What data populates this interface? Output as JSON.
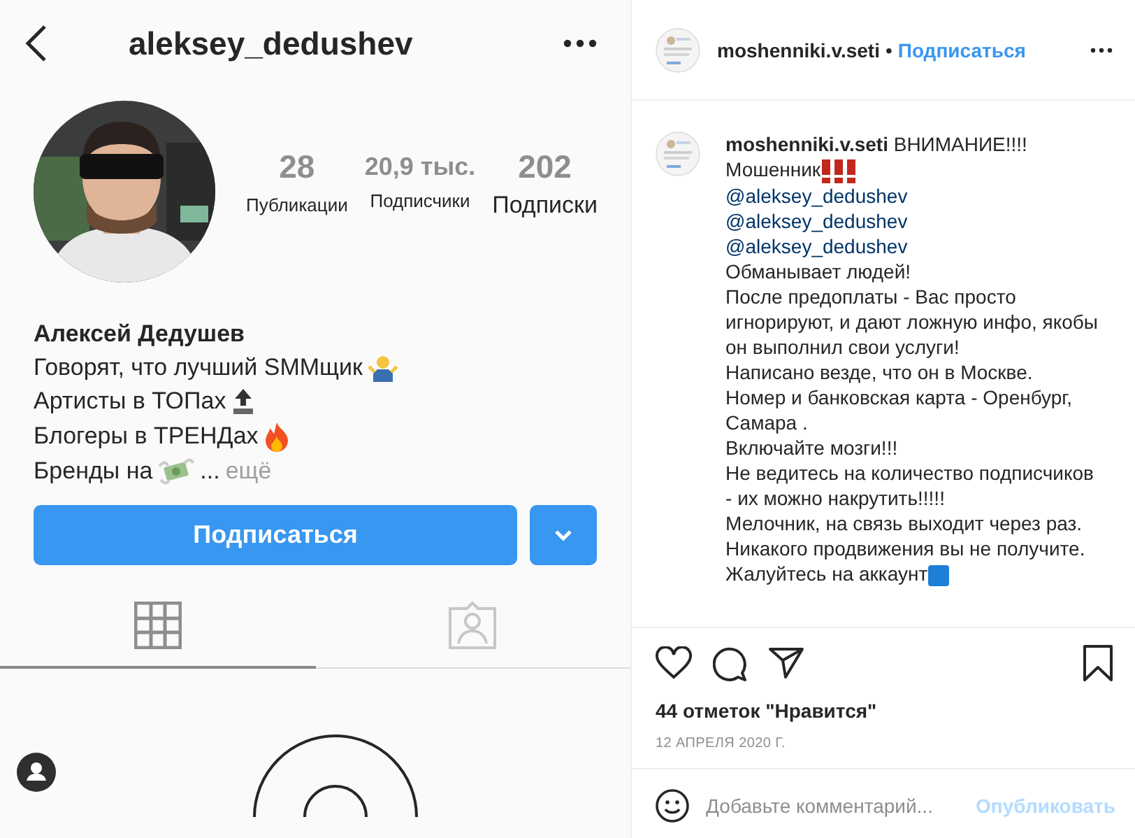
{
  "profile_screenshot": {
    "username": "aleksey_dedushev",
    "stats": [
      {
        "value": "28",
        "label": "Публикации"
      },
      {
        "value": "20,9 тыс.",
        "label": "Подписчики"
      },
      {
        "value": "202",
        "label": "Подписки"
      }
    ],
    "name": "Алексей Дедушев",
    "bio": [
      "Говорят, что лучший SMMщик",
      "Артисты в ТОПах",
      "Блогеры в ТРЕНДах",
      "Бренды на"
    ],
    "bio_ellipsis": "...",
    "more": "ещё",
    "follow_button": "Подписаться",
    "tabs": [
      {
        "kind": "grid",
        "selected": true
      },
      {
        "kind": "tagged",
        "selected": false
      }
    ]
  },
  "post": {
    "author": "moshenniki.v.seti",
    "separator": "•",
    "follow_link": "Подписаться",
    "caption": {
      "author": "moshenniki.v.seti",
      "paragraphs": [
        {
          "kind": "text",
          "text": "ВНИМАНИЕ!!!!"
        },
        {
          "kind": "alert",
          "text": "Мошенник"
        },
        {
          "kind": "mention",
          "text": "@aleksey_dedushev"
        },
        {
          "kind": "mention",
          "text": "@aleksey_dedushev"
        },
        {
          "kind": "mention",
          "text": "@aleksey_dedushev"
        },
        {
          "kind": "text",
          "text": "Обманывает людей!"
        },
        {
          "kind": "text",
          "text": "После предоплаты - Вас просто игнорируют, и дают ложную инфо, якобы он выполнил свои услуги!"
        },
        {
          "kind": "text",
          "text": "Написано везде, что он в Москве."
        },
        {
          "kind": "text",
          "text": "Номер и банковская карта - Оренбург, Самара ."
        },
        {
          "kind": "text",
          "text": "Включайте мозги!!!"
        },
        {
          "kind": "text",
          "text": "Не ведитесь на количество подписчиков - их можно накрутить!!!!!"
        },
        {
          "kind": "text",
          "text": "Мелочник, на связь выходит через раз. Никакого продвижения вы не получите."
        },
        {
          "kind": "text",
          "text": "Жалуйтесь на аккаунт"
        }
      ]
    },
    "likes": "44 отметок \"Нравится\"",
    "date": "12 АПРЕЛЯ 2020 Г.",
    "comment_placeholder": "Добавьте комментарий...",
    "publish_button": "Опубликовать"
  }
}
